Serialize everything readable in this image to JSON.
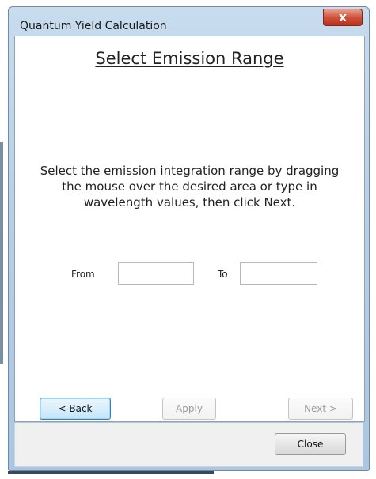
{
  "window": {
    "title": "Quantum Yield Calculation",
    "close_glyph": "x"
  },
  "main": {
    "heading": "Select Emission Range",
    "instructions": "Select the emission integration range by dragging the mouse over the desired area or type in wavelength values, then click Next.",
    "from_label": "From",
    "from_value": "",
    "to_label": "To",
    "to_value": ""
  },
  "buttons": {
    "back": "< Back",
    "apply": "Apply",
    "next": "Next >",
    "close": "Close"
  }
}
